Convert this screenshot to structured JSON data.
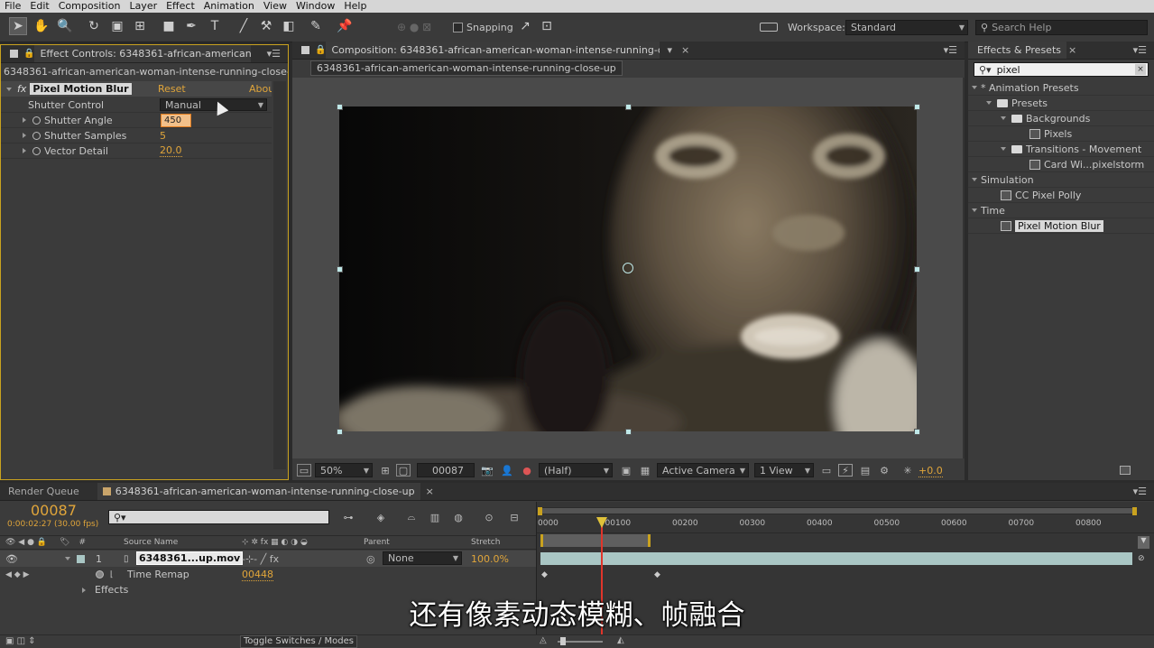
{
  "menu": [
    "File",
    "Edit",
    "Composition",
    "Layer",
    "Effect",
    "Animation",
    "View",
    "Window",
    "Help"
  ],
  "toolbar": {
    "snapping_label": "Snapping",
    "workspace_label": "Workspace:",
    "workspace_value": "Standard",
    "search_help_placeholder": "Search Help"
  },
  "effect_controls": {
    "tab_title": "Effect Controls: 6348361-african-american-woma",
    "layer_path": "6348361-african-american-woman-intense-running-close-up • 6348",
    "effect_name": "Pixel Motion Blur",
    "reset_label": "Reset",
    "about_label": "Abou",
    "properties": [
      {
        "name": "Shutter Control",
        "value": "Manual"
      },
      {
        "name": "Shutter Angle",
        "value": "450"
      },
      {
        "name": "Shutter Samples",
        "value": "5"
      },
      {
        "name": "Vector Detail",
        "value": "20.0"
      }
    ]
  },
  "composition": {
    "tab_title": "Composition: 6348361-african-american-woman-intense-running-close-up",
    "sub_tab": "6348361-african-american-woman-intense-running-close-up",
    "zoom": "50%",
    "timecode": "00087",
    "resolution": "(Half)",
    "camera": "Active Camera",
    "views": "1 View",
    "exposure": "+0.0"
  },
  "effects_presets": {
    "tab_title": "Effects & Presets",
    "search_value": "pixel",
    "tree": [
      {
        "label": "* Animation Presets",
        "level": 0,
        "type": "category",
        "open": true
      },
      {
        "label": "Presets",
        "level": 1,
        "type": "folder",
        "open": true
      },
      {
        "label": "Backgrounds",
        "level": 2,
        "type": "folder",
        "open": true
      },
      {
        "label": "Pixels",
        "level": 3,
        "type": "preset"
      },
      {
        "label": "Transitions - Movement",
        "level": 2,
        "type": "folder",
        "open": true
      },
      {
        "label": "Card Wi...pixelstorm",
        "level": 3,
        "type": "preset"
      },
      {
        "label": "Simulation",
        "level": 0,
        "type": "category",
        "open": true
      },
      {
        "label": "CC Pixel Polly",
        "level": 1,
        "type": "effect"
      },
      {
        "label": "Time",
        "level": 0,
        "type": "category",
        "open": true
      },
      {
        "label": "Pixel Motion Blur",
        "level": 1,
        "type": "effect",
        "selected": true
      }
    ]
  },
  "timeline": {
    "render_queue_tab": "Render Queue",
    "comp_tab": "6348361-african-american-woman-intense-running-close-up",
    "current_frame": "00087",
    "current_time": "0:00:02:27 (30.00 fps)",
    "search_placeholder": "",
    "columns": {
      "num": "#",
      "source": "Source Name",
      "parent": "Parent",
      "stretch": "Stretch"
    },
    "layer": {
      "index": "1",
      "name": "6348361...up.mov",
      "parent": "None",
      "stretch": "100.0%"
    },
    "time_remap_label": "Time Remap",
    "time_remap_value": "00448",
    "effects_label": "Effects",
    "ruler": [
      "0000",
      "00100",
      "00200",
      "00300",
      "00400",
      "00500",
      "00600",
      "00700",
      "00800"
    ],
    "toggle_label": "Toggle Switches / Modes"
  },
  "subtitle": "还有像素动态模糊、帧融合",
  "colors": {
    "accent": "#e0a53a",
    "layer_bar": "#a9c6c4",
    "playhead": "#e0352b"
  }
}
